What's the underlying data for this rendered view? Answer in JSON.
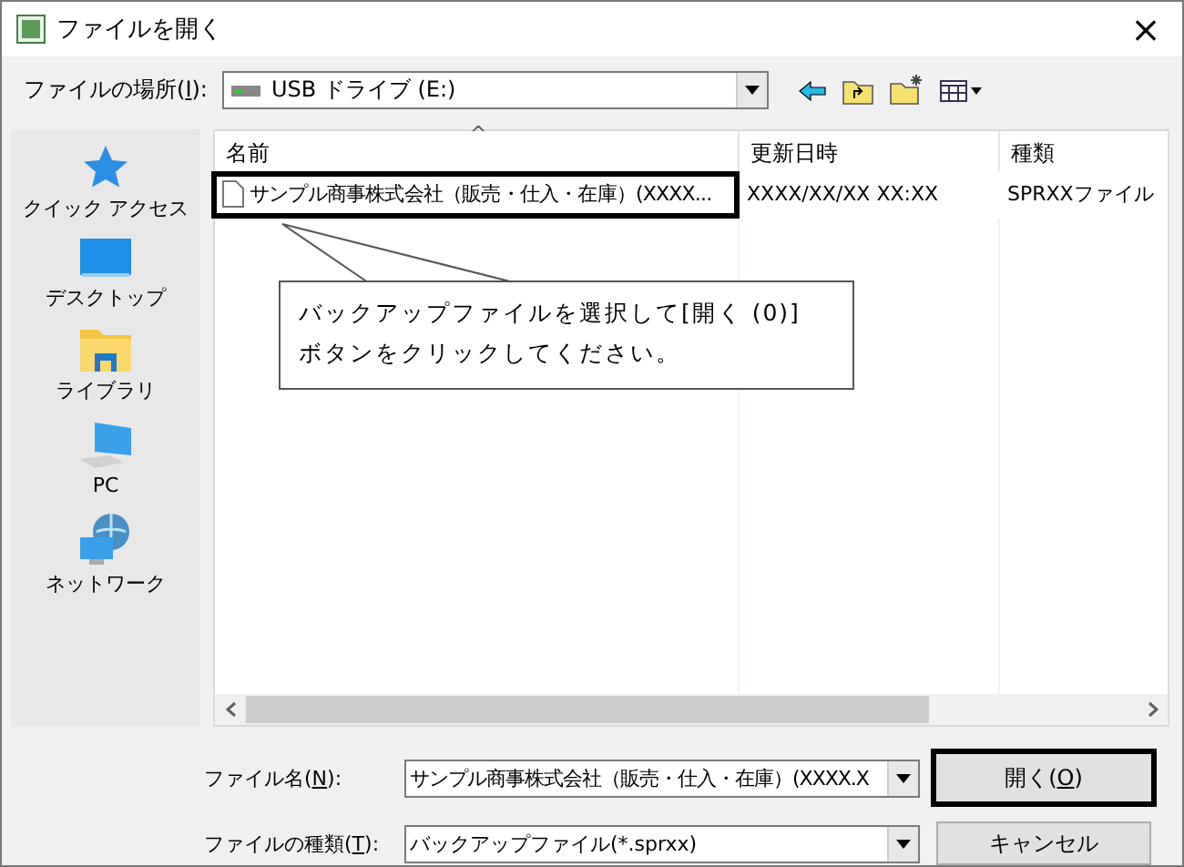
{
  "window": {
    "title": "ファイルを開く",
    "close": "×"
  },
  "location": {
    "label": {
      "before": "ファイルの場所(",
      "key": "I",
      "after": "):"
    },
    "value": "USB ドライブ (E:)"
  },
  "sidebar": {
    "items": [
      {
        "label": "クイック アクセス",
        "kind": "star"
      },
      {
        "label": "デスクトップ",
        "kind": "desktop"
      },
      {
        "label": "ライブラリ",
        "kind": "library"
      },
      {
        "label": "PC",
        "kind": "pc"
      },
      {
        "label": "ネットワーク",
        "kind": "network"
      }
    ]
  },
  "table": {
    "columns": [
      "名前",
      "更新日時",
      "種類"
    ],
    "sort_mark": "^",
    "rows": [
      {
        "name": "サンプル商事株式会社（販売・仕入・在庫）(XXXX...",
        "modified": "XXXX/XX/XX XX:XX",
        "type": "SPRXXファイル",
        "highlighted": true
      }
    ]
  },
  "callout": {
    "lines": [
      "バックアップファイルを選択して[開く (0)]",
      "ボタンをクリックしてください。"
    ]
  },
  "file_name": {
    "label": {
      "before": "ファイル名(",
      "key": "N",
      "after": "):"
    },
    "value": "サンプル商事株式会社（販売・仕入・在庫）(XXXX.X"
  },
  "file_type": {
    "label": {
      "before": "ファイルの種類(",
      "key": "T",
      "after": "):"
    },
    "value": "バックアップファイル(*.sprxx)"
  },
  "buttons": [
    {
      "label": {
        "before": "開く(",
        "key": "O",
        "after": ")"
      },
      "highlighted": true
    },
    {
      "label": {
        "before": "キャンセル"
      },
      "highlighted": false
    }
  ]
}
